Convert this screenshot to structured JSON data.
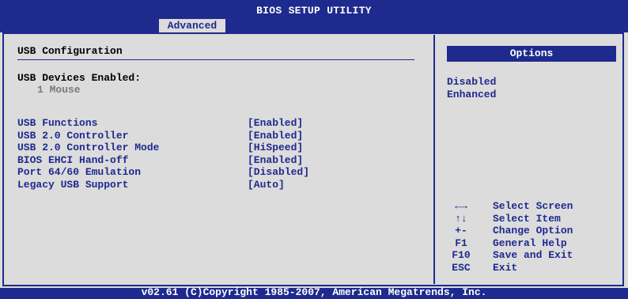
{
  "header": {
    "title": "BIOS SETUP UTILITY",
    "active_tab": "Advanced"
  },
  "main": {
    "section_title": "USB Configuration",
    "devices_label": "USB Devices Enabled:",
    "devices_value": "1 Mouse",
    "settings": [
      {
        "label": "USB Functions",
        "value": "[Enabled]"
      },
      {
        "label": "USB 2.0 Controller",
        "value": "[Enabled]"
      },
      {
        "label": "USB 2.0 Controller Mode",
        "value": "[HiSpeed]"
      },
      {
        "label": "BIOS EHCI Hand-off",
        "value": "[Enabled]"
      },
      {
        "label": "Port 64/60 Emulation",
        "value": "[Disabled]"
      },
      {
        "label": "Legacy USB Support",
        "value": "[Auto]"
      }
    ]
  },
  "options_panel": {
    "header": "Options",
    "items": [
      "Disabled",
      "Enhanced"
    ]
  },
  "help": [
    {
      "key": "←→",
      "action": "Select Screen"
    },
    {
      "key": "↑↓",
      "action": "Select Item"
    },
    {
      "key": "+-",
      "action": "Change Option"
    },
    {
      "key": "F1",
      "action": "General Help"
    },
    {
      "key": "F10",
      "action": "Save and Exit"
    },
    {
      "key": "ESC",
      "action": "Exit"
    }
  ],
  "footer": {
    "copyright": "v02.61 (C)Copyright 1985-2007, American Megatrends, Inc."
  },
  "colors": {
    "bios_blue": "#1e2a8e",
    "panel_gray": "#dcdcdc",
    "dim_text": "#7a7a7a"
  }
}
